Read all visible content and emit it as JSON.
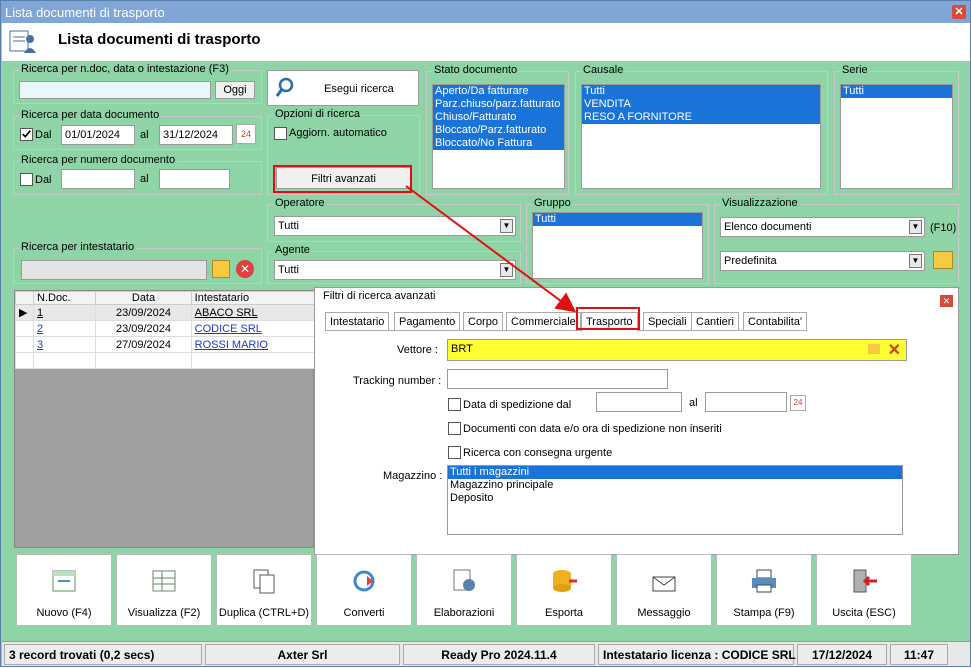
{
  "window": {
    "title": "Lista documenti di trasporto"
  },
  "header": {
    "title": "Lista documenti di trasporto"
  },
  "search": {
    "ndoc_legend": "Ricerca per n.doc, data o intestazione (F3)",
    "ndoc_value": "",
    "ogg_button": "Oggi",
    "exec_button": "Esegui ricerca"
  },
  "date_search": {
    "legend": "Ricerca per data documento",
    "dal": "Dal",
    "from": "01/01/2024",
    "al": "al",
    "to": "31/12/2024"
  },
  "num_search": {
    "legend": "Ricerca per numero documento",
    "dal": "Dal",
    "from": "",
    "al": "al",
    "to": ""
  },
  "options": {
    "legend": "Opzioni di ricerca",
    "auto": "Aggiorn. automatico",
    "advanced_button": "Filtri avanzati"
  },
  "intestatario": {
    "legend": "Ricerca per intestatario",
    "value": ""
  },
  "stato": {
    "legend": "Stato documento",
    "items": [
      "Aperto/Da fatturare",
      "Parz.chiuso/parz.fatturato",
      "Chiuso/Fatturato",
      "Bloccato/Parz.fatturato",
      "Bloccato/No Fattura"
    ]
  },
  "causale": {
    "legend": "Causale",
    "items": [
      "Tutti",
      "VENDITA",
      "RESO A FORNITORE"
    ]
  },
  "serie": {
    "legend": "Serie",
    "items": [
      "Tutti"
    ]
  },
  "operatore": {
    "legend": "Operatore",
    "value": "Tutti"
  },
  "agente": {
    "legend": "Agente",
    "value": "Tutti"
  },
  "gruppo": {
    "legend": "Gruppo",
    "items": [
      "Tutti"
    ]
  },
  "visualizzazione": {
    "legend": "Visualizzazione",
    "value1": "Elenco documenti",
    "shortcut": "(F10)",
    "value2": "Predefinita"
  },
  "grid": {
    "columns": [
      "N.Doc.",
      "Data",
      "Intestatario"
    ],
    "rows": [
      {
        "n": "1",
        "data": "23/09/2024",
        "int": "ABACO SRL"
      },
      {
        "n": "2",
        "data": "23/09/2024",
        "int": "CODICE SRL"
      },
      {
        "n": "3",
        "data": "27/09/2024",
        "int": "ROSSI MARIO"
      }
    ]
  },
  "advanced": {
    "title": "Filtri di ricerca avanzati",
    "tabs": [
      "Intestatario",
      "Pagamento",
      "Corpo",
      "Commerciale",
      "Trasporto",
      "Speciali",
      "Cantieri",
      "Contabilita'"
    ],
    "vettore_label": "Vettore :",
    "vettore_value": "BRT",
    "tracking_label": "Tracking number :",
    "tracking_value": "",
    "spedizione": "Data di spedizione dal",
    "al": "al",
    "non_inseriti": "Documenti con data e/o ora di spedizione non inseriti",
    "urgente": "Ricerca con consegna urgente",
    "magazzino_label": "Magazzino :",
    "magazzini": [
      "Tutti i magazzini",
      "Magazzino principale",
      "Deposito"
    ]
  },
  "toolbar": {
    "nuovo": "Nuovo (F4)",
    "visualizza": "Visualizza (F2)",
    "duplica": "Duplica (CTRL+D)",
    "converti": "Converti",
    "elaborazioni": "Elaborazioni",
    "esporta": "Esporta",
    "messaggio": "Messaggio",
    "stampa": "Stampa (F9)",
    "uscita": "Uscita (ESC)"
  },
  "status": {
    "records": "3 record trovati (0,2 secs)",
    "company": "Axter Srl",
    "version": "Ready Pro 2024.11.4",
    "license": "Intestatario licenza : CODICE SRL",
    "date": "17/12/2024",
    "time": "11:47"
  },
  "colors": {
    "bg": "#8fd4a6",
    "select": "#1a73d9",
    "highlight": "#ffff33",
    "annotation": "#e01010"
  }
}
